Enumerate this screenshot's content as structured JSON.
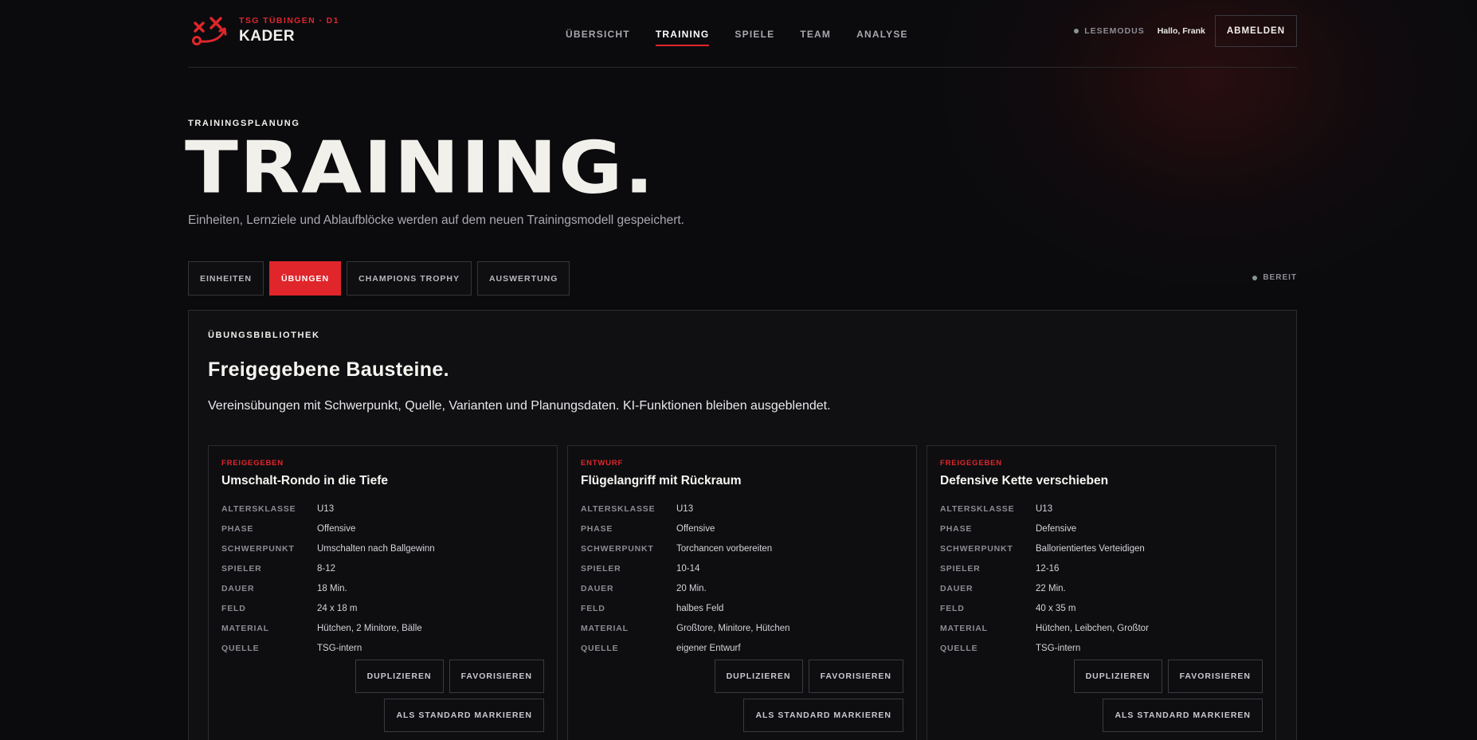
{
  "brand": {
    "sub": "TSG TÜBINGEN · D1",
    "title": "KADER",
    "logo_icon": "tactics-board-logo",
    "accent_color": "#e0262b"
  },
  "nav": [
    "ÜBERSICHT",
    "TRAINING",
    "SPIELE",
    "TEAM",
    "ANALYSE"
  ],
  "nav_active": "TRAINING",
  "header": {
    "mode": "LESEMODUS",
    "greeting": "Hallo, Frank",
    "logout": "ABMELDEN"
  },
  "hero": {
    "eyebrow": "TRAININGSPLANUNG",
    "title": "TRAINING.",
    "subtitle": "Einheiten, Lernziele und Ablaufblöcke werden auf dem neuen Trainingsmodell gespeichert."
  },
  "tabs": [
    "EINHEITEN",
    "ÜBUNGEN",
    "CHAMPIONS TROPHY",
    "AUSWERTUNG"
  ],
  "tab_active": "ÜBUNGEN",
  "status": "BEREIT",
  "library": {
    "eyebrow": "ÜBUNGSBIBLIOTHEK",
    "title": "Freigegebene Bausteine.",
    "subtitle": "Vereinsübungen mit Schwerpunkt, Quelle, Varianten und Planungsdaten. KI-Funktionen bleiben ausgeblendet.",
    "labels": [
      "ALTERSKLASSE",
      "PHASE",
      "SCHWERPUNKT",
      "SPIELER",
      "DAUER",
      "FELD",
      "MATERIAL",
      "QUELLE"
    ],
    "buttons": {
      "duplicate": "DUPLIZIEREN",
      "favorite": "FAVORISIEREN",
      "standard": "ALS STANDARD MARKIEREN"
    },
    "cards": [
      {
        "status": "FREIGEGEBEN",
        "title": "Umschalt-Rondo in die Tiefe",
        "values": [
          "U13",
          "Offensive",
          "Umschalten nach Ballgewinn",
          "8-12",
          "18 Min.",
          "24 x 18 m",
          "Hütchen, 2 Minitore, Bälle",
          "TSG-intern"
        ]
      },
      {
        "status": "ENTWURF",
        "title": "Flügelangriff mit Rückraum",
        "values": [
          "U13",
          "Offensive",
          "Torchancen vorbereiten",
          "10-14",
          "20 Min.",
          "halbes Feld",
          "Großtore, Minitore, Hütchen",
          "eigener Entwurf"
        ]
      },
      {
        "status": "FREIGEGEBEN",
        "title": "Defensive Kette verschieben",
        "values": [
          "U13",
          "Defensive",
          "Ballorientiertes Verteidigen",
          "12-16",
          "22 Min.",
          "40 x 35 m",
          "Hütchen, Leibchen, Großtor",
          "TSG-intern"
        ]
      }
    ]
  }
}
